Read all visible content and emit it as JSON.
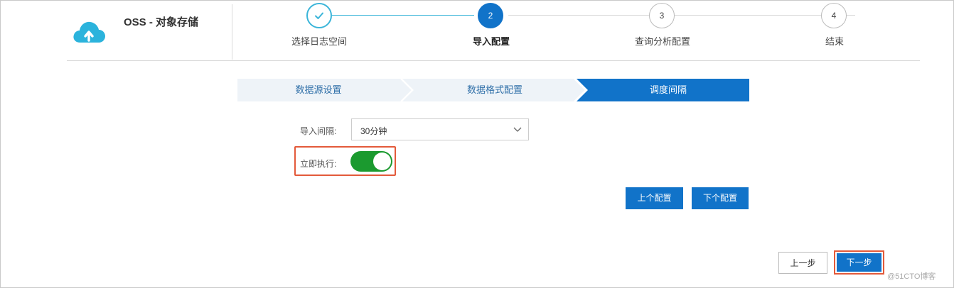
{
  "product": {
    "title": "OSS - 对象存储",
    "logo_icon": "cloud-upload-icon",
    "logo_color": "#2bb3dc"
  },
  "steps": [
    {
      "number": "",
      "label": "选择日志空间",
      "status": "done",
      "icon": "check-icon"
    },
    {
      "number": "2",
      "label": "导入配置",
      "status": "active"
    },
    {
      "number": "3",
      "label": "查询分析配置",
      "status": "todo"
    },
    {
      "number": "4",
      "label": "结束",
      "status": "todo"
    }
  ],
  "subtabs": [
    {
      "label": "数据源设置",
      "active": false
    },
    {
      "label": "数据格式配置",
      "active": false
    },
    {
      "label": "调度间隔",
      "active": true
    }
  ],
  "form": {
    "interval_label": "导入间隔:",
    "interval_value": "30分钟",
    "run_now_label": "立即执行:",
    "run_now_enabled": true
  },
  "buttons": {
    "prev_config": "上个配置",
    "next_config": "下个配置",
    "prev_step": "上一步",
    "next_step": "下一步"
  },
  "colors": {
    "primary": "#1173c9",
    "done_step": "#3bb5d9",
    "toggle_on": "#1b9a2f",
    "highlight": "#e35a3a",
    "subtab_inactive": "#eef3f8"
  },
  "watermark": "@51CTO博客"
}
